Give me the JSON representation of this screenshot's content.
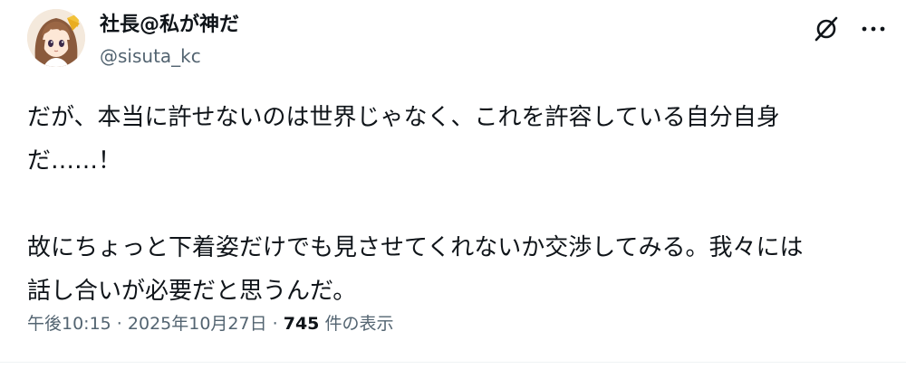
{
  "author": {
    "display_name": "社長@私が神だ",
    "handle": "@sisuta_kc",
    "avatar_icon": "avatar-anime-girl"
  },
  "actions": {
    "grok_icon": "grok-icon",
    "more_icon": "more-dots-icon"
  },
  "body": {
    "line1": "だが、本当に許せないのは世界じゃなく、これを許容している自分自身",
    "line2": "だ……！",
    "line3": "故にちょっと下着姿だけでも見させてくれないか交渉してみる。我々には",
    "line4": "話し合いが必要だと思うんだ。"
  },
  "meta": {
    "time": "午後10:15",
    "sep1": " · ",
    "date": "2025年10月27日",
    "sep2": " · ",
    "views_count": "745",
    "views_label": " 件の表示"
  },
  "colors": {
    "text": "#0f1419",
    "secondary": "#536471",
    "divider": "#eff3f4"
  }
}
